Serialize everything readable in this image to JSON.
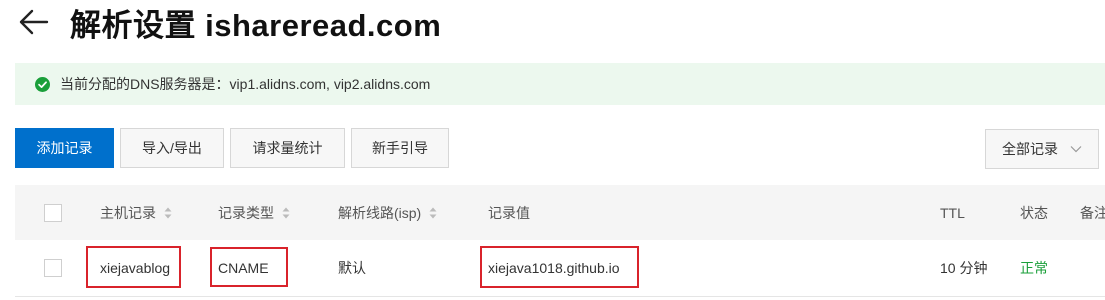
{
  "header": {
    "title": "解析设置 ishareread.com"
  },
  "notice": {
    "text": "当前分配的DNS服务器是：vip1.alidns.com, vip2.alidns.com"
  },
  "toolbar": {
    "add_label": "添加记录",
    "import_label": "导入/导出",
    "stats_label": "请求量统计",
    "guide_label": "新手引导"
  },
  "filter": {
    "selected": "全部记录"
  },
  "table": {
    "headers": {
      "host": "主机记录",
      "type": "记录类型",
      "line": "解析线路(isp)",
      "value": "记录值",
      "ttl": "TTL",
      "status": "状态",
      "remark": "备注"
    },
    "rows": [
      {
        "host": "xiejavablog",
        "type": "CNAME",
        "line": "默认",
        "value": "xiejava1018.github.io",
        "ttl": "10 分钟",
        "status": "正常"
      }
    ]
  },
  "colors": {
    "primary": "#0070cc",
    "notice_bg": "#ecf8ee",
    "success": "#1a9f3a",
    "highlight": "#d9232b"
  }
}
